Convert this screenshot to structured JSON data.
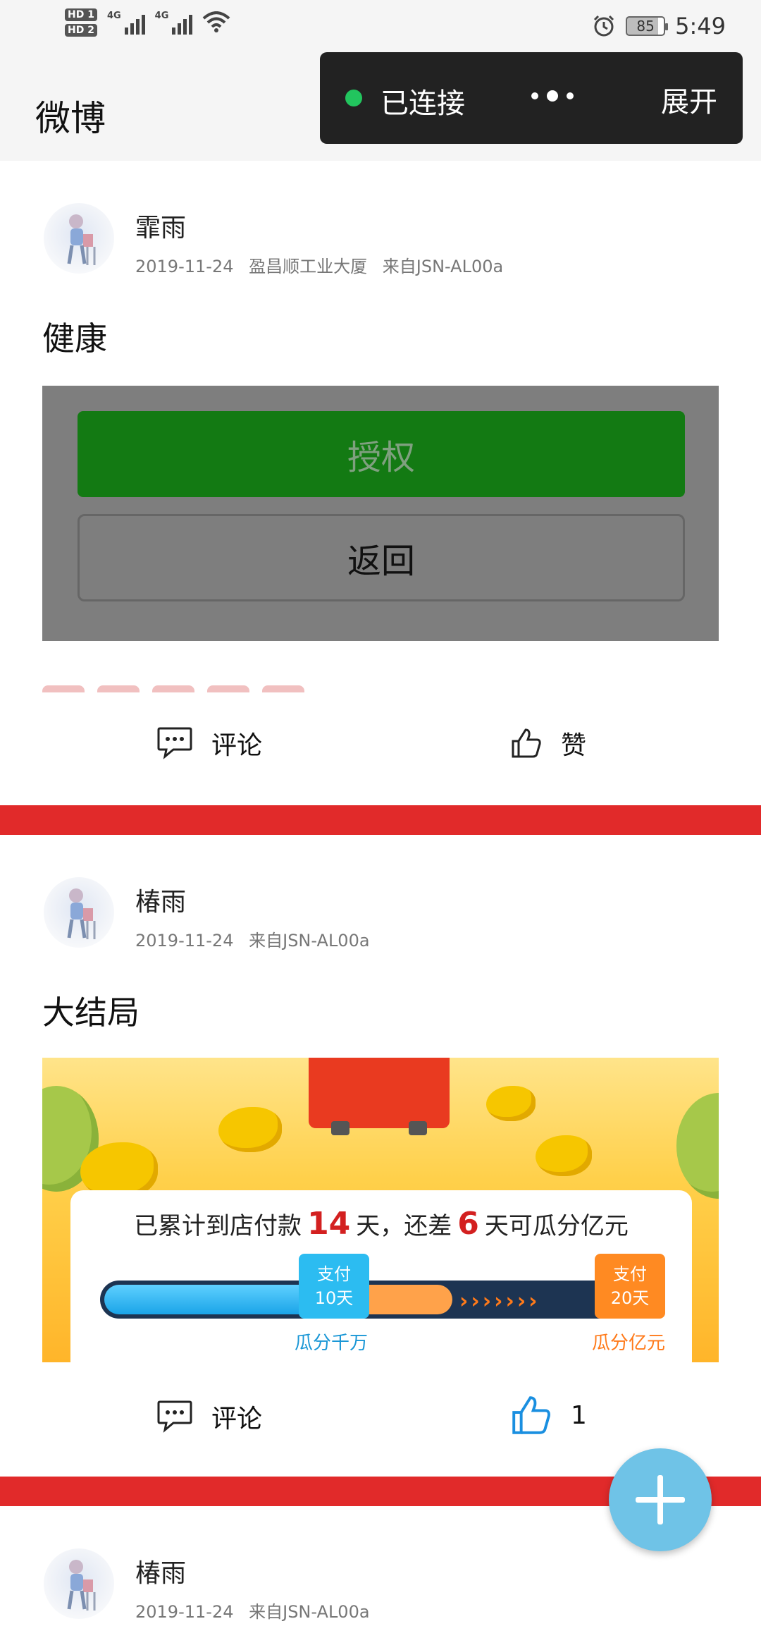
{
  "status_bar": {
    "hd1": "HD 1",
    "hd2": "HD 2",
    "net1": "4G",
    "net2": "4G",
    "battery": "85",
    "time": "5:49"
  },
  "header": {
    "title": "微博"
  },
  "connection_pill": {
    "status": "已连接",
    "expand_label": "展开",
    "status_color": "#22c55e"
  },
  "posts": [
    {
      "user": "霏雨",
      "date": "2019-11-24",
      "location": "盈昌顺工业大厦",
      "source": "来自JSN-AL00a",
      "text": "健康",
      "dialog": {
        "authorize_label": "授权",
        "back_label": "返回"
      },
      "actions": {
        "comment_label": "评论",
        "like_label": "赞"
      }
    },
    {
      "user": "椿雨",
      "date": "2019-11-24",
      "source": "来自JSN-AL00a",
      "text": "大结局",
      "banner": {
        "line_prefix": "已累计到店付款",
        "days_paid": "14",
        "line_mid": "天，还差",
        "days_left": "6",
        "line_suffix": "天可瓜分亿元",
        "progress": 0.7,
        "tag1_line1": "支付",
        "tag1_line2": "10天",
        "tag2_line1": "支付",
        "tag2_line2": "20天",
        "milestone1": "瓜分千万",
        "milestone2": "瓜分亿元"
      },
      "actions": {
        "comment_label": "评论",
        "like_count": "1"
      }
    },
    {
      "user": "椿雨",
      "date": "2019-11-24",
      "source": "来自JSN-AL00a"
    }
  ],
  "colors": {
    "divider": "#e12a2a",
    "fab": "#6fc3e7",
    "like_active": "#1a8fe0"
  },
  "icons": {
    "comment": "comment-icon",
    "like": "thumb-up-icon",
    "fab": "plus-icon"
  }
}
